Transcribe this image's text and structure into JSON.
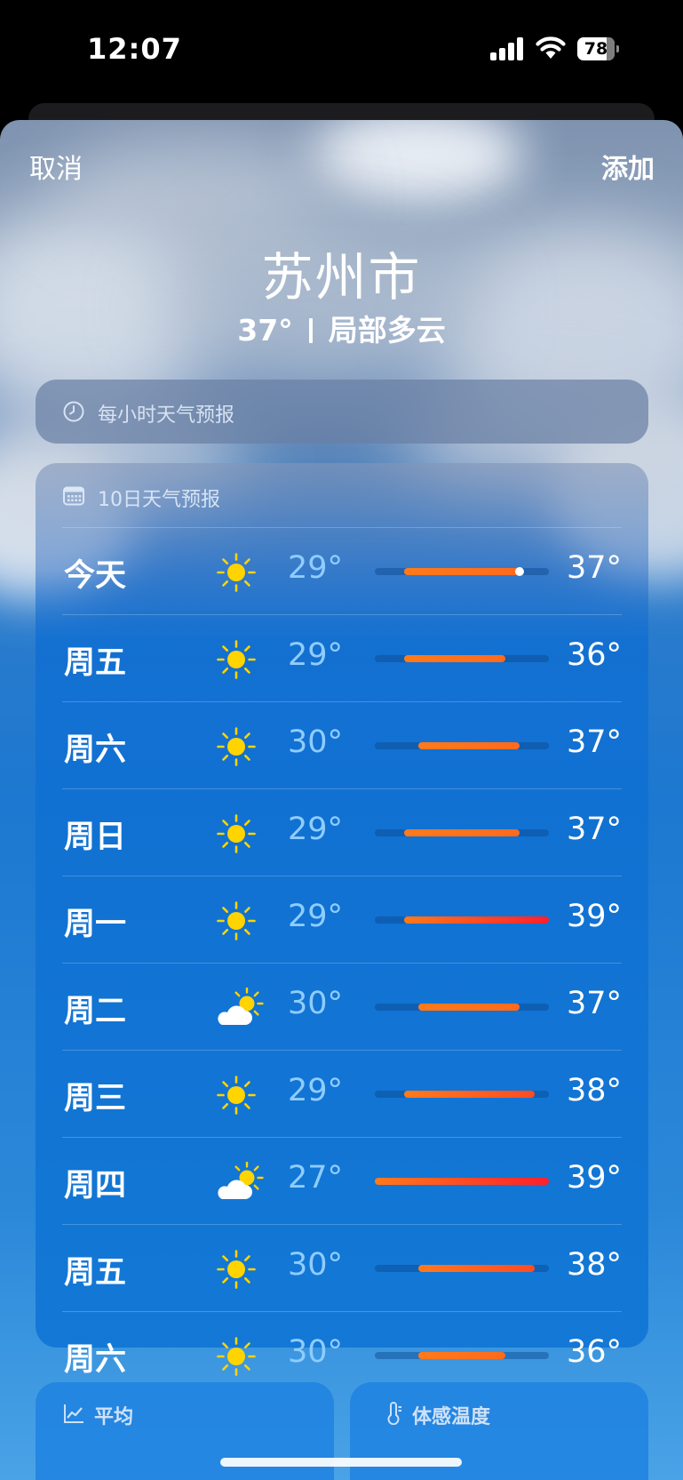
{
  "status_bar": {
    "time": "12:07",
    "battery": "78"
  },
  "nav": {
    "cancel": "取消",
    "add": "添加"
  },
  "location": {
    "city": "苏州市",
    "temperature": "37°",
    "condition": "局部多云"
  },
  "hourly": {
    "label": "每小时天气预报",
    "icon": "clock-icon"
  },
  "daily": {
    "label": "10日天气预报",
    "icon": "calendar-icon",
    "range_min": 27,
    "range_max": 39,
    "current_temp": 37,
    "days": [
      {
        "day": "今天",
        "icon": "sunny",
        "low": "29°",
        "high": "37°",
        "low_value": 29,
        "high_value": 37
      },
      {
        "day": "周五",
        "icon": "sunny",
        "low": "29°",
        "high": "36°",
        "low_value": 29,
        "high_value": 36
      },
      {
        "day": "周六",
        "icon": "sunny",
        "low": "30°",
        "high": "37°",
        "low_value": 30,
        "high_value": 37
      },
      {
        "day": "周日",
        "icon": "sunny",
        "low": "29°",
        "high": "37°",
        "low_value": 29,
        "high_value": 37
      },
      {
        "day": "周一",
        "icon": "sunny",
        "low": "29°",
        "high": "39°",
        "low_value": 29,
        "high_value": 39
      },
      {
        "day": "周二",
        "icon": "partly-cloudy",
        "low": "30°",
        "high": "37°",
        "low_value": 30,
        "high_value": 37
      },
      {
        "day": "周三",
        "icon": "sunny",
        "low": "29°",
        "high": "38°",
        "low_value": 29,
        "high_value": 38
      },
      {
        "day": "周四",
        "icon": "partly-cloudy",
        "low": "27°",
        "high": "39°",
        "low_value": 27,
        "high_value": 39
      },
      {
        "day": "周五",
        "icon": "sunny",
        "low": "30°",
        "high": "38°",
        "low_value": 30,
        "high_value": 38
      },
      {
        "day": "周六",
        "icon": "sunny",
        "low": "30°",
        "high": "36°",
        "low_value": 30,
        "high_value": 36
      }
    ]
  },
  "average_card": {
    "label": "平均",
    "icon": "trend-chart-icon"
  },
  "feels_like_card": {
    "label": "体感温度",
    "icon": "thermometer-icon"
  },
  "colors": {
    "bar_orange": "#ff7a1a",
    "bar_red": "#ff1f2d",
    "low_temp_text": "#8fcdff",
    "sun_yellow": "#ffd400"
  }
}
